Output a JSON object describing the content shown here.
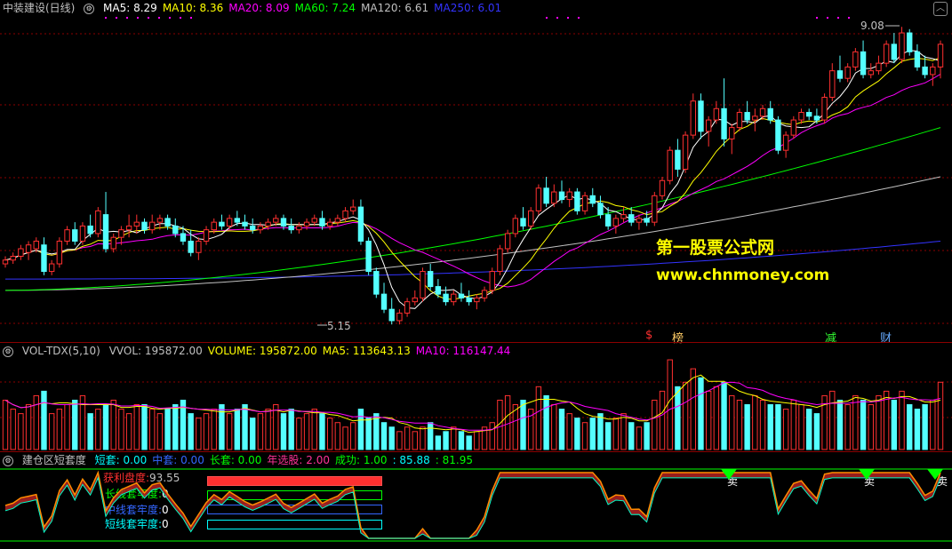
{
  "main": {
    "title": "中装建设(日线)",
    "ma": [
      {
        "label": "MA5:",
        "value": "8.29",
        "color": "#ffffff"
      },
      {
        "label": "MA10:",
        "value": "8.36",
        "color": "#ffff00"
      },
      {
        "label": "MA20:",
        "value": "8.09",
        "color": "#ff00ff"
      },
      {
        "label": "MA60:",
        "value": "7.24",
        "color": "#00ff00"
      },
      {
        "label": "MA120:",
        "value": "6.61",
        "color": "#c0c0c0"
      },
      {
        "label": "MA250:",
        "value": "6.01",
        "color": "#3333ff"
      }
    ],
    "high_label": "9.08",
    "low_label": "5.15",
    "markers": [
      {
        "text": "$",
        "color": "#ff3030"
      },
      {
        "text": "榜",
        "color": "#ffcc66"
      },
      {
        "text": "减",
        "color": "#33ff33"
      },
      {
        "text": "财",
        "color": "#66aaff"
      }
    ],
    "watermark_cn": "第一股票公式网",
    "watermark_url": "www.chnmoney.com",
    "colors": {
      "up": "#ff3030",
      "down": "#54ffff",
      "grid": "#8b0000"
    }
  },
  "vol": {
    "title": "VOL-TDX(5,10)",
    "items": [
      {
        "label": "VVOL:",
        "value": "195872.00",
        "color": "#c0c0c0"
      },
      {
        "label": "VOLUME:",
        "value": "195872.00",
        "color": "#ffff00"
      },
      {
        "label": "MA5:",
        "value": "113643.13",
        "color": "#ffff00"
      },
      {
        "label": "MA10:",
        "value": "116147.44",
        "color": "#ff00ff"
      }
    ]
  },
  "ind": {
    "title": "建仓区短套度",
    "items": [
      {
        "label": "短套:",
        "value": "0.00",
        "color": "#00ffff"
      },
      {
        "label": "中套:",
        "value": "0.00",
        "color": "#3366ff"
      },
      {
        "label": "长套:",
        "value": "0.00",
        "color": "#00ff00"
      },
      {
        "label": "年选股:",
        "value": "2.00",
        "color": "#ff3399"
      },
      {
        "label": "成功:",
        "value": "1.00",
        "color": "#00ff00"
      },
      {
        "label": ":",
        "value": "85.88",
        "color": "#00ffff"
      },
      {
        "label": ":",
        "value": "81.95",
        "color": "#00ff00"
      }
    ],
    "legend": [
      {
        "label": "获利盘度:",
        "value": "93.55",
        "color": "#ff3030"
      },
      {
        "label": "长线套牢度:",
        "value": "0",
        "color": "#00ff00"
      },
      {
        "label": "中线套牢度:",
        "value": "0",
        "color": "#3366ff"
      },
      {
        "label": "短线套牢度:",
        "value": "0",
        "color": "#00ffff"
      }
    ],
    "sell_label": "卖"
  },
  "chart_data": {
    "type": "candlestick",
    "price_range": [
      5.0,
      9.2
    ],
    "ohlc": [
      [
        5.95,
        6.05,
        5.9,
        6.0
      ],
      [
        6.0,
        6.1,
        5.95,
        6.05
      ],
      [
        6.05,
        6.2,
        6.0,
        6.15
      ],
      [
        6.1,
        6.25,
        6.0,
        6.2
      ],
      [
        6.15,
        6.3,
        6.1,
        6.25
      ],
      [
        6.2,
        6.3,
        5.8,
        5.85
      ],
      [
        5.85,
        6.0,
        5.8,
        5.95
      ],
      [
        5.95,
        6.3,
        5.9,
        6.25
      ],
      [
        6.25,
        6.45,
        6.2,
        6.4
      ],
      [
        6.4,
        6.5,
        6.2,
        6.25
      ],
      [
        6.25,
        6.5,
        6.2,
        6.45
      ],
      [
        6.45,
        6.6,
        6.3,
        6.35
      ],
      [
        6.35,
        6.7,
        6.3,
        6.65
      ],
      [
        6.6,
        6.9,
        6.1,
        6.15
      ],
      [
        6.15,
        6.35,
        6.1,
        6.3
      ],
      [
        6.3,
        6.45,
        6.2,
        6.4
      ],
      [
        6.4,
        6.6,
        6.3,
        6.45
      ],
      [
        6.45,
        6.6,
        6.35,
        6.5
      ],
      [
        6.5,
        6.55,
        6.35,
        6.4
      ],
      [
        6.4,
        6.6,
        6.35,
        6.5
      ],
      [
        6.5,
        6.6,
        6.4,
        6.55
      ],
      [
        6.55,
        6.6,
        6.4,
        6.45
      ],
      [
        6.45,
        6.55,
        6.3,
        6.35
      ],
      [
        6.35,
        6.45,
        6.2,
        6.25
      ],
      [
        6.25,
        6.4,
        6.05,
        6.1
      ],
      [
        6.1,
        6.3,
        6.0,
        6.25
      ],
      [
        6.25,
        6.45,
        6.2,
        6.4
      ],
      [
        6.4,
        6.55,
        6.35,
        6.5
      ],
      [
        6.5,
        6.6,
        6.4,
        6.45
      ],
      [
        6.45,
        6.6,
        6.4,
        6.55
      ],
      [
        6.55,
        6.65,
        6.45,
        6.5
      ],
      [
        6.5,
        6.6,
        6.4,
        6.45
      ],
      [
        6.45,
        6.55,
        6.35,
        6.4
      ],
      [
        6.4,
        6.5,
        6.35,
        6.45
      ],
      [
        6.45,
        6.55,
        6.4,
        6.5
      ],
      [
        6.5,
        6.6,
        6.45,
        6.55
      ],
      [
        6.55,
        6.6,
        6.4,
        6.45
      ],
      [
        6.45,
        6.55,
        6.35,
        6.4
      ],
      [
        6.4,
        6.5,
        6.35,
        6.45
      ],
      [
        6.45,
        6.55,
        6.4,
        6.5
      ],
      [
        6.5,
        6.6,
        6.45,
        6.55
      ],
      [
        6.55,
        6.65,
        6.4,
        6.45
      ],
      [
        6.45,
        6.55,
        6.4,
        6.5
      ],
      [
        6.5,
        6.6,
        6.45,
        6.55
      ],
      [
        6.55,
        6.7,
        6.5,
        6.65
      ],
      [
        6.65,
        6.8,
        6.6,
        6.7
      ],
      [
        6.7,
        6.8,
        6.2,
        6.25
      ],
      [
        6.25,
        6.3,
        5.8,
        5.85
      ],
      [
        5.85,
        5.9,
        5.5,
        5.55
      ],
      [
        5.55,
        5.7,
        5.3,
        5.35
      ],
      [
        5.35,
        5.5,
        5.15,
        5.2
      ],
      [
        5.2,
        5.35,
        5.15,
        5.3
      ],
      [
        5.3,
        5.5,
        5.25,
        5.45
      ],
      [
        5.45,
        5.6,
        5.4,
        5.5
      ],
      [
        5.5,
        5.9,
        5.45,
        5.85
      ],
      [
        5.85,
        5.95,
        5.6,
        5.65
      ],
      [
        5.65,
        5.75,
        5.5,
        5.55
      ],
      [
        5.55,
        5.65,
        5.4,
        5.45
      ],
      [
        5.45,
        5.6,
        5.4,
        5.55
      ],
      [
        5.55,
        5.7,
        5.45,
        5.5
      ],
      [
        5.5,
        5.6,
        5.4,
        5.45
      ],
      [
        5.45,
        5.55,
        5.35,
        5.5
      ],
      [
        5.5,
        5.65,
        5.45,
        5.6
      ],
      [
        5.6,
        5.9,
        5.55,
        5.85
      ],
      [
        5.85,
        6.2,
        5.8,
        6.15
      ],
      [
        6.15,
        6.4,
        6.1,
        6.35
      ],
      [
        6.35,
        6.6,
        6.3,
        6.55
      ],
      [
        6.55,
        6.7,
        6.4,
        6.45
      ],
      [
        6.45,
        6.7,
        6.4,
        6.65
      ],
      [
        6.65,
        7.0,
        6.6,
        6.95
      ],
      [
        6.95,
        7.1,
        6.7,
        6.75
      ],
      [
        6.75,
        7.0,
        6.7,
        6.9
      ],
      [
        6.9,
        7.05,
        6.75,
        6.8
      ],
      [
        6.8,
        6.95,
        6.7,
        6.9
      ],
      [
        6.9,
        6.95,
        6.6,
        6.65
      ],
      [
        6.65,
        6.9,
        6.6,
        6.85
      ],
      [
        6.85,
        6.95,
        6.7,
        6.75
      ],
      [
        6.75,
        6.85,
        6.55,
        6.6
      ],
      [
        6.6,
        6.7,
        6.4,
        6.45
      ],
      [
        6.45,
        6.6,
        6.35,
        6.55
      ],
      [
        6.55,
        6.7,
        6.5,
        6.6
      ],
      [
        6.6,
        6.7,
        6.45,
        6.5
      ],
      [
        6.5,
        6.6,
        6.4,
        6.55
      ],
      [
        6.55,
        6.65,
        6.45,
        6.5
      ],
      [
        6.5,
        6.9,
        6.45,
        6.85
      ],
      [
        6.85,
        7.1,
        6.8,
        7.05
      ],
      [
        7.05,
        7.5,
        7.0,
        7.45
      ],
      [
        7.45,
        7.6,
        7.1,
        7.2
      ],
      [
        7.2,
        7.7,
        7.15,
        7.65
      ],
      [
        7.65,
        8.2,
        7.6,
        8.1
      ],
      [
        8.1,
        8.2,
        7.6,
        7.7
      ],
      [
        7.7,
        7.9,
        7.5,
        7.85
      ],
      [
        7.85,
        8.1,
        7.8,
        8.0
      ],
      [
        8.0,
        8.4,
        7.5,
        7.6
      ],
      [
        7.6,
        7.8,
        7.4,
        7.75
      ],
      [
        7.75,
        8.0,
        7.7,
        7.95
      ],
      [
        7.95,
        8.1,
        7.8,
        7.85
      ],
      [
        7.85,
        8.0,
        7.7,
        7.9
      ],
      [
        7.9,
        8.05,
        7.85,
        8.0
      ],
      [
        8.0,
        8.1,
        7.8,
        7.85
      ],
      [
        7.85,
        7.9,
        7.4,
        7.45
      ],
      [
        7.45,
        7.7,
        7.35,
        7.65
      ],
      [
        7.65,
        7.9,
        7.6,
        7.85
      ],
      [
        7.85,
        8.0,
        7.8,
        7.95
      ],
      [
        7.95,
        8.0,
        7.85,
        7.9
      ],
      [
        7.9,
        8.0,
        7.8,
        7.85
      ],
      [
        7.85,
        8.2,
        7.8,
        8.15
      ],
      [
        8.15,
        8.6,
        8.1,
        8.5
      ],
      [
        8.5,
        8.7,
        8.35,
        8.4
      ],
      [
        8.4,
        8.6,
        8.35,
        8.55
      ],
      [
        8.55,
        8.8,
        8.5,
        8.75
      ],
      [
        8.75,
        8.9,
        8.4,
        8.45
      ],
      [
        8.45,
        8.6,
        8.4,
        8.5
      ],
      [
        8.5,
        8.7,
        8.45,
        8.6
      ],
      [
        8.6,
        8.9,
        8.55,
        8.85
      ],
      [
        8.85,
        9.0,
        8.6,
        8.65
      ],
      [
        8.65,
        9.08,
        8.6,
        9.0
      ],
      [
        9.0,
        9.05,
        8.7,
        8.75
      ],
      [
        8.75,
        8.85,
        8.5,
        8.55
      ],
      [
        8.55,
        8.7,
        8.4,
        8.45
      ],
      [
        8.45,
        8.6,
        8.3,
        8.55
      ],
      [
        8.55,
        8.9,
        8.4,
        8.85
      ]
    ],
    "volume": [
      1.1,
      0.9,
      0.8,
      1.0,
      1.2,
      1.3,
      0.8,
      0.9,
      1.0,
      1.1,
      1.2,
      0.8,
      0.9,
      1.0,
      1.1,
      0.9,
      0.8,
      1.0,
      1.0,
      0.9,
      0.8,
      0.9,
      1.0,
      1.1,
      0.8,
      0.7,
      0.8,
      0.9,
      1.0,
      0.8,
      0.9,
      1.0,
      0.7,
      0.8,
      0.9,
      1.0,
      0.8,
      0.9,
      0.7,
      0.8,
      0.9,
      0.8,
      0.7,
      0.6,
      0.5,
      0.6,
      0.9,
      0.7,
      0.8,
      0.6,
      0.5,
      0.4,
      0.5,
      0.4,
      0.5,
      0.6,
      0.3,
      0.4,
      0.5,
      0.4,
      0.3,
      0.4,
      0.5,
      0.6,
      1.1,
      1.2,
      1.0,
      1.1,
      0.9,
      1.4,
      1.2,
      1.0,
      0.9,
      0.8,
      0.7,
      0.6,
      0.7,
      0.8,
      0.6,
      0.7,
      0.8,
      0.6,
      0.5,
      0.6,
      1.1,
      1.3,
      2.0,
      1.4,
      1.5,
      1.8,
      1.6,
      1.3,
      1.4,
      1.5,
      1.2,
      1.1,
      1.0,
      1.2,
      1.1,
      1.0,
      1.0,
      0.9,
      1.1,
      1.0,
      0.9,
      0.8,
      1.2,
      1.3,
      1.1,
      1.0,
      1.2,
      1.1,
      1.0,
      1.2,
      1.3,
      1.1,
      1.3,
      1.0,
      0.9,
      1.0,
      1.1,
      1.5
    ]
  }
}
